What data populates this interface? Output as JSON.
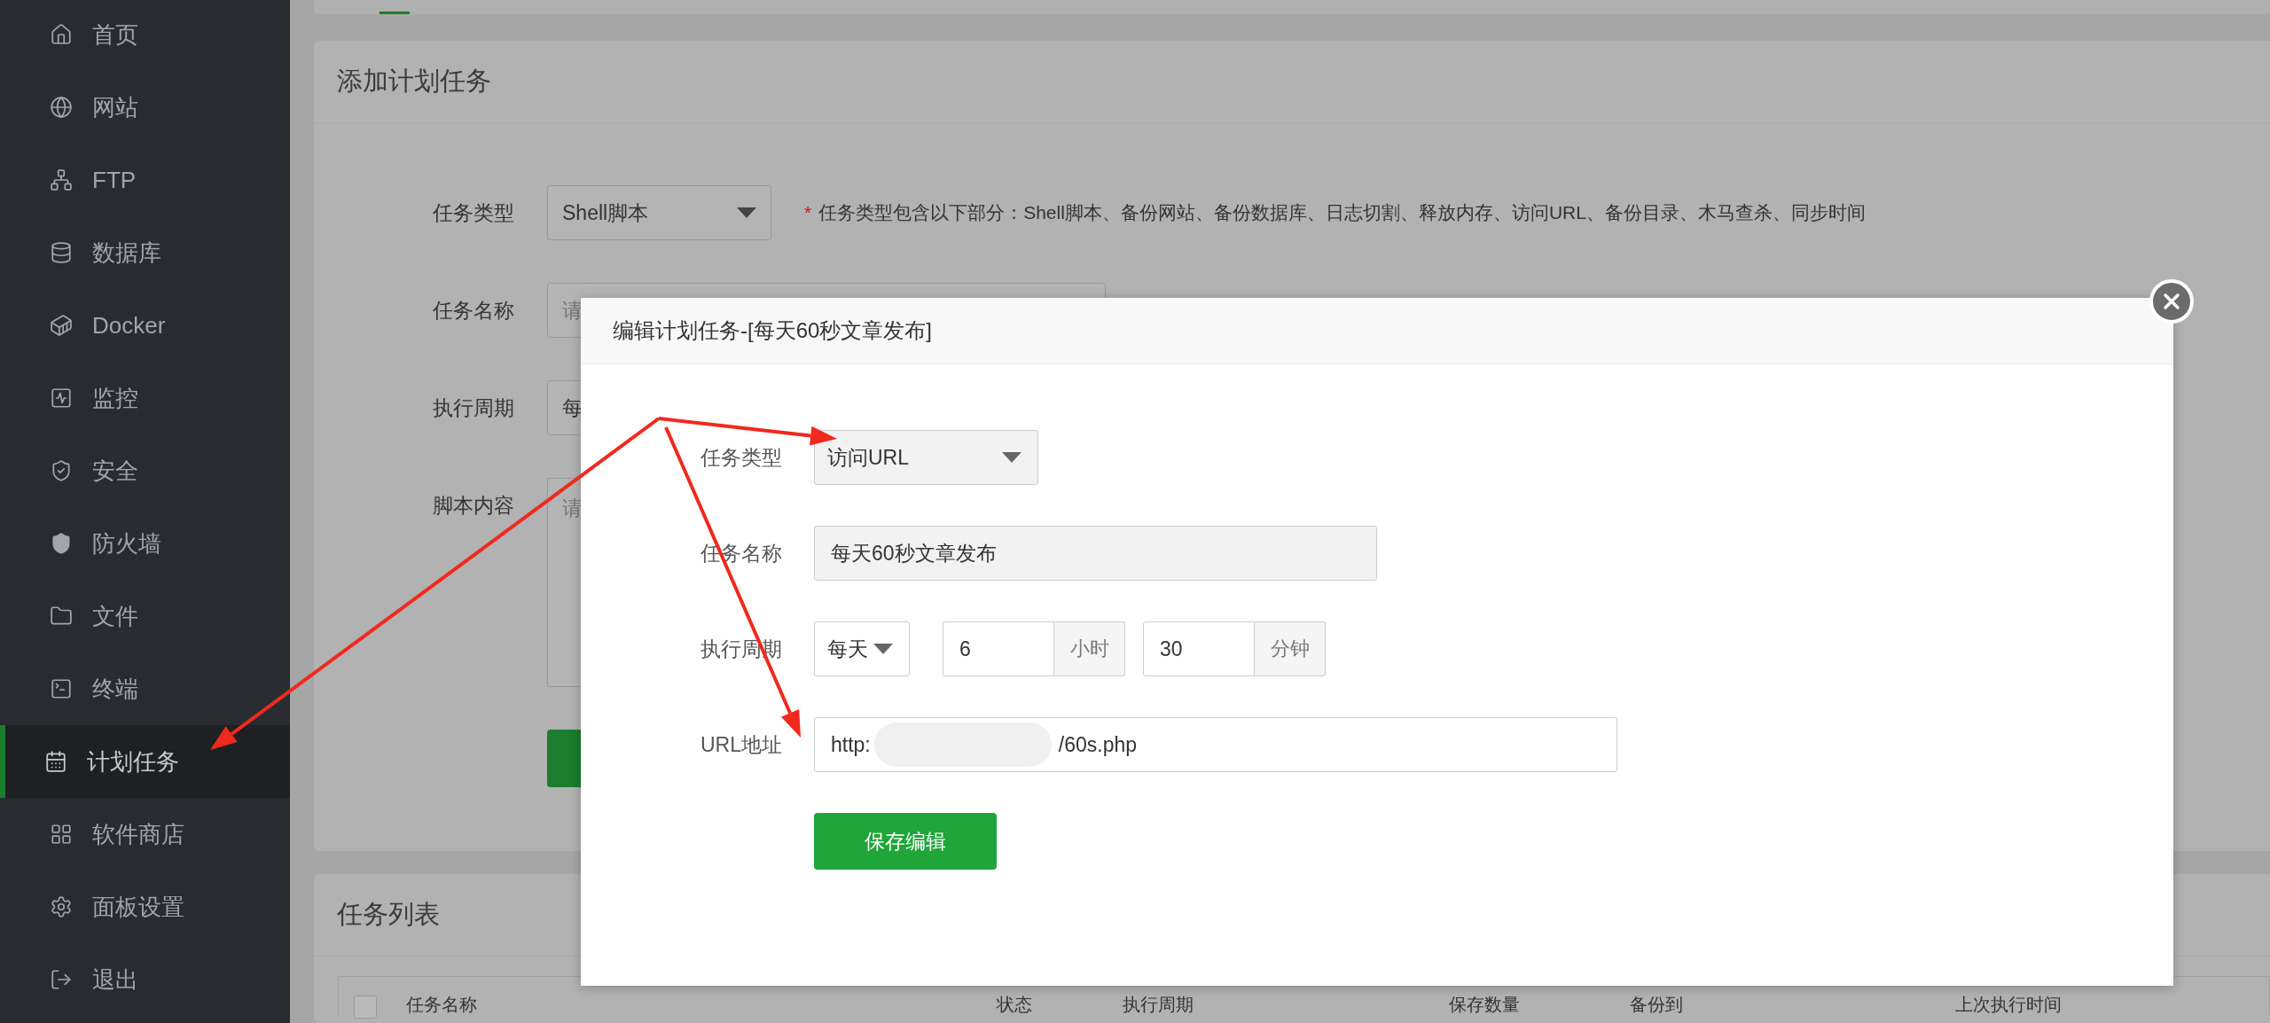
{
  "sidebar": {
    "items": [
      {
        "label": "首页",
        "selected": false
      },
      {
        "label": "网站",
        "selected": false
      },
      {
        "label": "FTP",
        "selected": false
      },
      {
        "label": "数据库",
        "selected": false
      },
      {
        "label": "Docker",
        "selected": false
      },
      {
        "label": "监控",
        "selected": false
      },
      {
        "label": "安全",
        "selected": false
      },
      {
        "label": "防火墙",
        "selected": false
      },
      {
        "label": "文件",
        "selected": false
      },
      {
        "label": "终端",
        "selected": false
      },
      {
        "label": "计划任务",
        "selected": true
      },
      {
        "label": "软件商店",
        "selected": false
      },
      {
        "label": "面板设置",
        "selected": false
      },
      {
        "label": "退出",
        "selected": false
      }
    ]
  },
  "add_task": {
    "title": "添加计划任务",
    "fields": [
      {
        "kind": "select",
        "label": "任务类型",
        "value": "Shell脚本",
        "hint_mark": "*",
        "hint": "任务类型包含以下部分：Shell脚本、备份网站、备份数据库、日志切割、释放内存、访问URL、备份目录、木马查杀、同步时间"
      },
      {
        "kind": "input",
        "label": "任务名称",
        "placeholder": "请"
      },
      {
        "kind": "select",
        "label": "执行周期",
        "value": "每"
      },
      {
        "kind": "textarea",
        "label": "脚本内容",
        "placeholder": "请"
      }
    ]
  },
  "task_list": {
    "title": "任务列表",
    "select_all": {
      "checked": false
    },
    "columns": [
      "任务名称",
      "状态",
      "执行周期",
      "保存数量",
      "备份到",
      "上次执行时间"
    ]
  },
  "modal": {
    "title": "编辑计划任务-[每天60秒文章发布]",
    "task_type": {
      "label": "任务类型",
      "value": "访问URL"
    },
    "task_name": {
      "label": "任务名称",
      "value": "每天60秒文章发布"
    },
    "cycle": {
      "label": "执行周期",
      "period": "每天",
      "hour": "6",
      "hour_unit": "小时",
      "minute": "30",
      "minute_unit": "分钟"
    },
    "url": {
      "label": "URL地址",
      "value_start": "http:",
      "value_end": "/60s.php"
    },
    "save_button": "保存编辑"
  }
}
